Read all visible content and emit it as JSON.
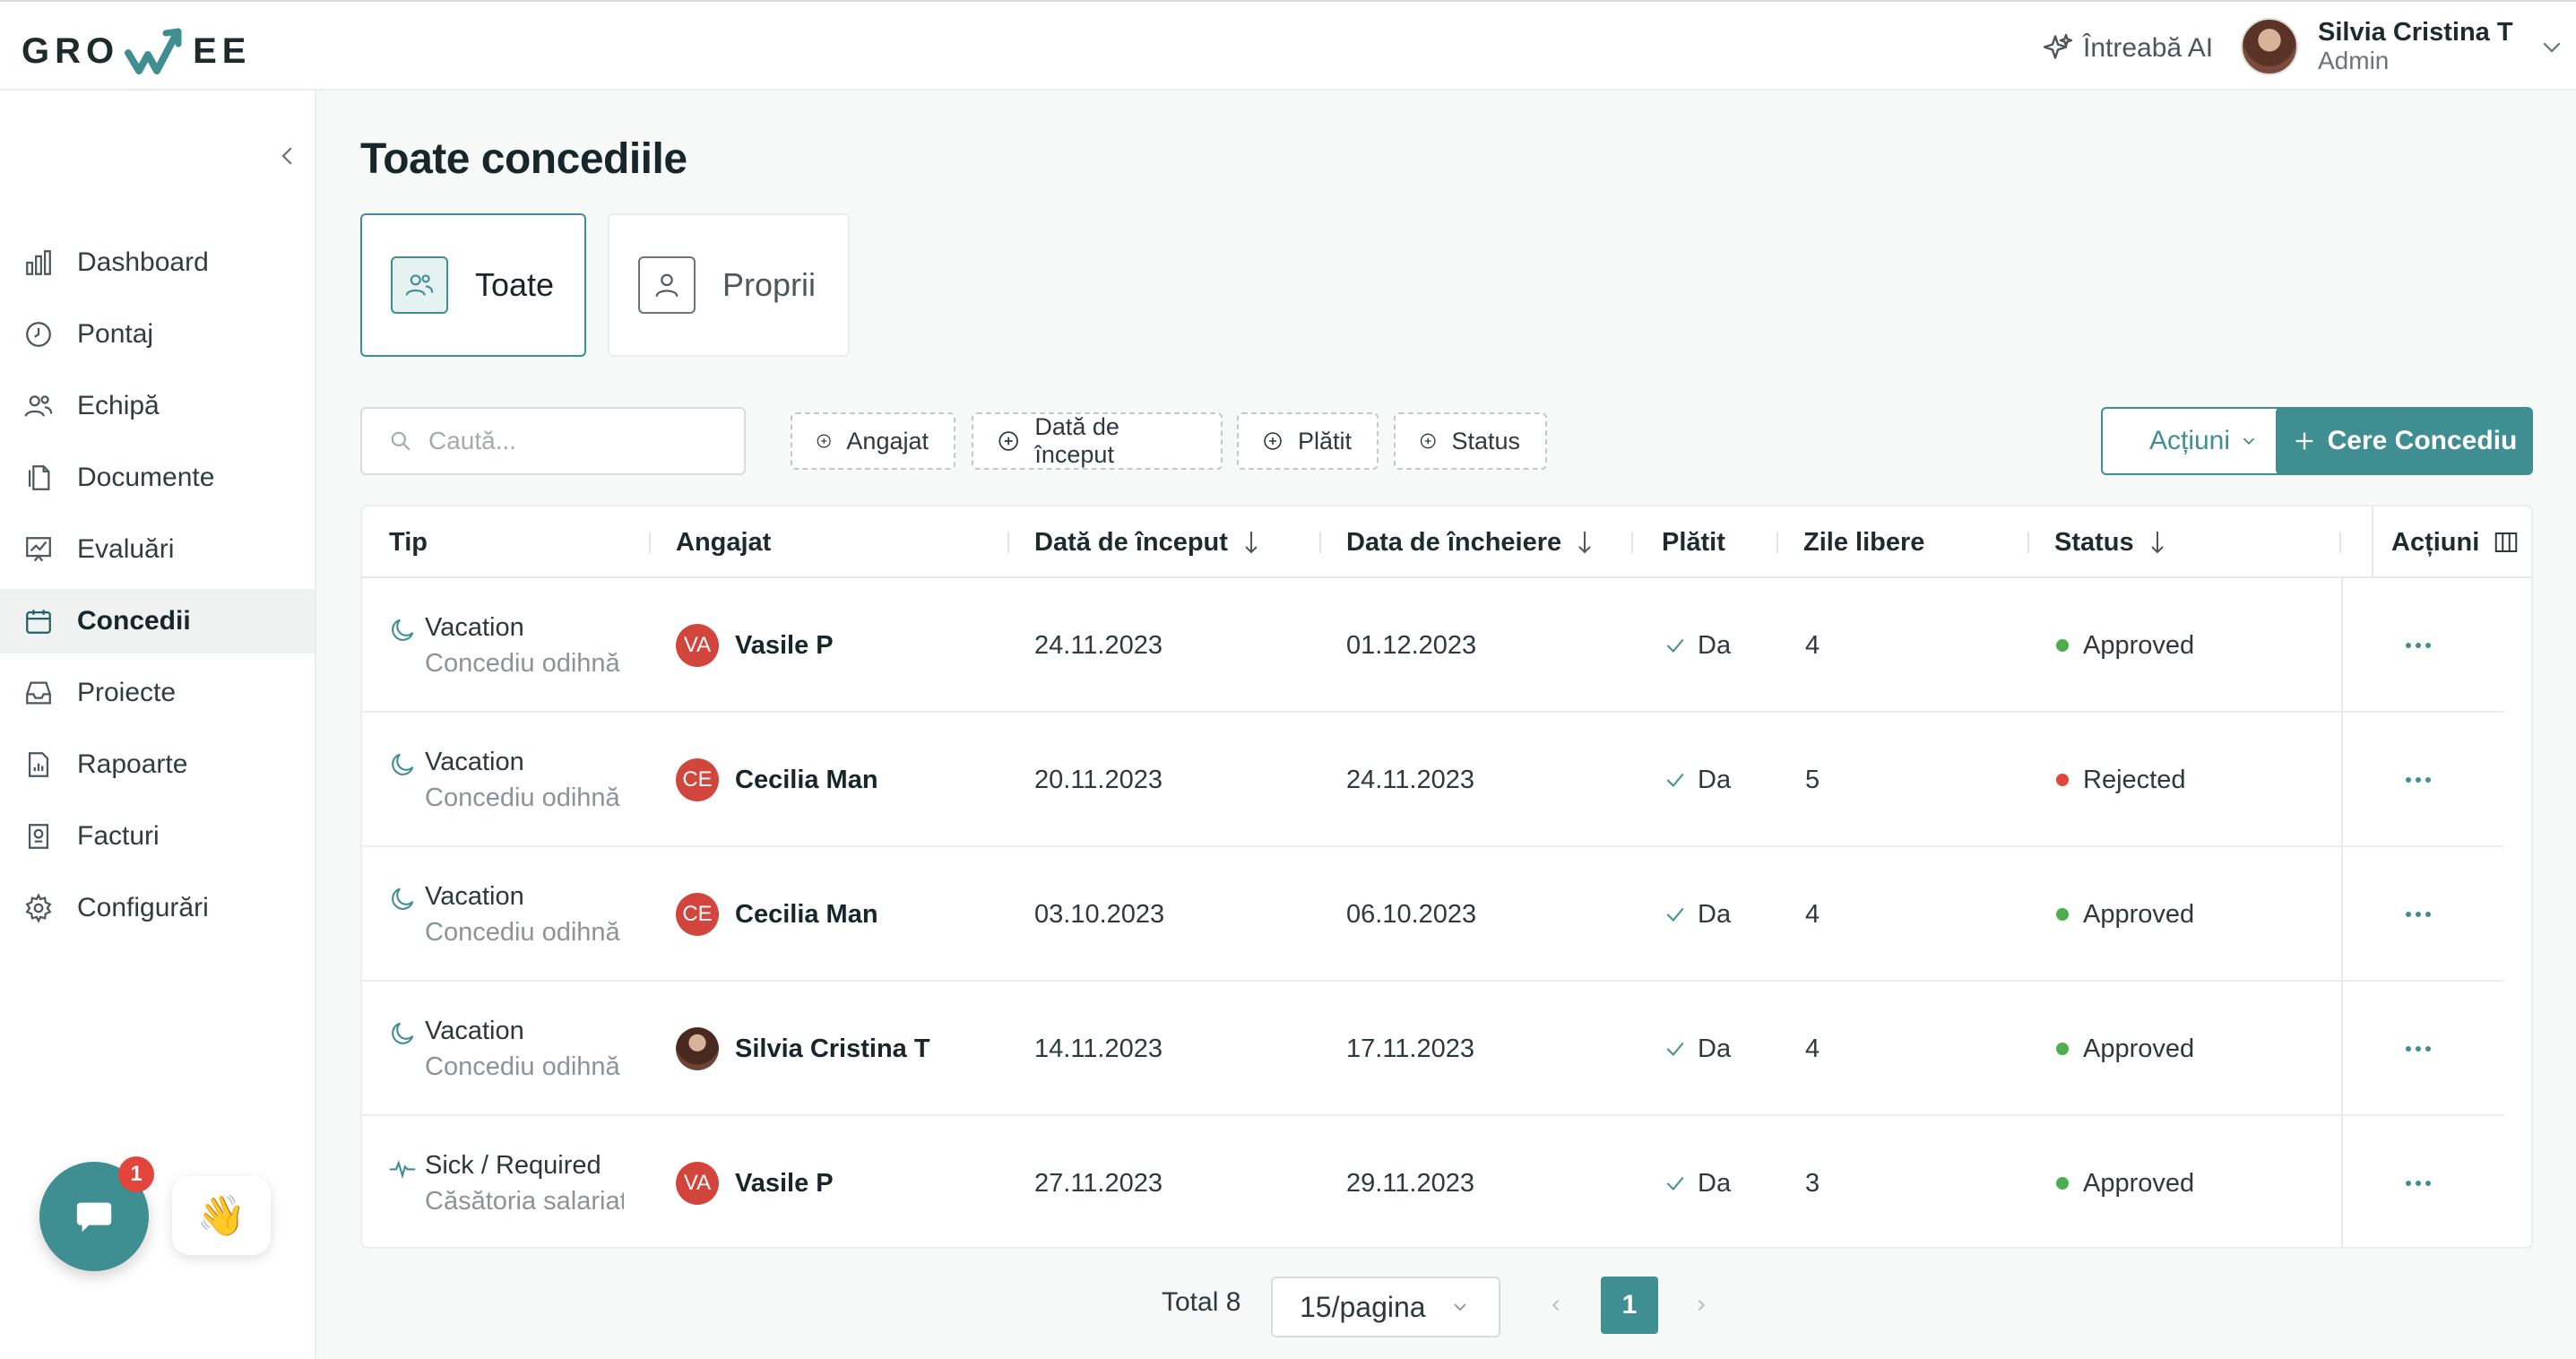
{
  "brand": {
    "logo_left": "GRO",
    "logo_right": "EE",
    "accent": "#3f8e92"
  },
  "header": {
    "ask_ai": "Întreabă AI",
    "user_name": "Silvia Cristina T",
    "user_role": "Admin"
  },
  "sidebar": {
    "items": [
      {
        "label": "Dashboard",
        "icon": "bar-chart-icon"
      },
      {
        "label": "Pontaj",
        "icon": "clock-icon"
      },
      {
        "label": "Echipă",
        "icon": "users-icon"
      },
      {
        "label": "Documente",
        "icon": "documents-icon"
      },
      {
        "label": "Evaluări",
        "icon": "chart-board-icon"
      },
      {
        "label": "Concedii",
        "icon": "calendar-icon",
        "active": true
      },
      {
        "label": "Proiecte",
        "icon": "inbox-icon"
      },
      {
        "label": "Rapoarte",
        "icon": "report-icon"
      },
      {
        "label": "Facturi",
        "icon": "invoice-icon"
      },
      {
        "label": "Configurări",
        "icon": "gear-icon"
      }
    ],
    "chat_badge": "1",
    "wave_emoji": "👋"
  },
  "page": {
    "title": "Toate concediile",
    "tabs": [
      "Toate",
      "Proprii"
    ],
    "search_placeholder": "Caută...",
    "filters": [
      "Angajat",
      "Dată de început",
      "Plătit",
      "Status"
    ],
    "actions_button": "Acțiuni",
    "primary_button": "Cere Concediu"
  },
  "table": {
    "columns": [
      "Tip",
      "Angajat",
      "Dată de început",
      "Data de încheiere",
      "Plătit",
      "Zile libere",
      "Status",
      "Acțiuni"
    ],
    "rows": [
      {
        "type": "Vacation",
        "subtype": "Concediu odihnă",
        "type_icon": "moon-icon",
        "initials": "VA",
        "employee": "Vasile P",
        "start": "24.11.2023",
        "end": "01.12.2023",
        "paid": "Da",
        "days": "4",
        "status": "Approved",
        "status_color": "#4cae4f"
      },
      {
        "type": "Vacation",
        "subtype": "Concediu odihnă",
        "type_icon": "moon-icon",
        "initials": "CE",
        "employee": "Cecilia Man",
        "start": "20.11.2023",
        "end": "24.11.2023",
        "paid": "Da",
        "days": "5",
        "status": "Rejected",
        "status_color": "#e2453c"
      },
      {
        "type": "Vacation",
        "subtype": "Concediu odihnă",
        "type_icon": "moon-icon",
        "initials": "CE",
        "employee": "Cecilia Man",
        "start": "03.10.2023",
        "end": "06.10.2023",
        "paid": "Da",
        "days": "4",
        "status": "Approved",
        "status_color": "#4cae4f"
      },
      {
        "type": "Vacation",
        "subtype": "Concediu odihnă",
        "type_icon": "moon-icon",
        "initials": "",
        "photo": true,
        "employee": "Silvia Cristina T",
        "start": "14.11.2023",
        "end": "17.11.2023",
        "paid": "Da",
        "days": "4",
        "status": "Approved",
        "status_color": "#4cae4f"
      },
      {
        "type": "Sick / Required",
        "subtype": "Căsătoria salariatului",
        "type_icon": "pulse-icon",
        "initials": "VA",
        "employee": "Vasile P",
        "start": "27.11.2023",
        "end": "29.11.2023",
        "paid": "Da",
        "days": "3",
        "status": "Approved",
        "status_color": "#4cae4f"
      }
    ]
  },
  "pagination": {
    "total": "Total 8",
    "per_page": "15/pagina",
    "current_page": "1"
  }
}
